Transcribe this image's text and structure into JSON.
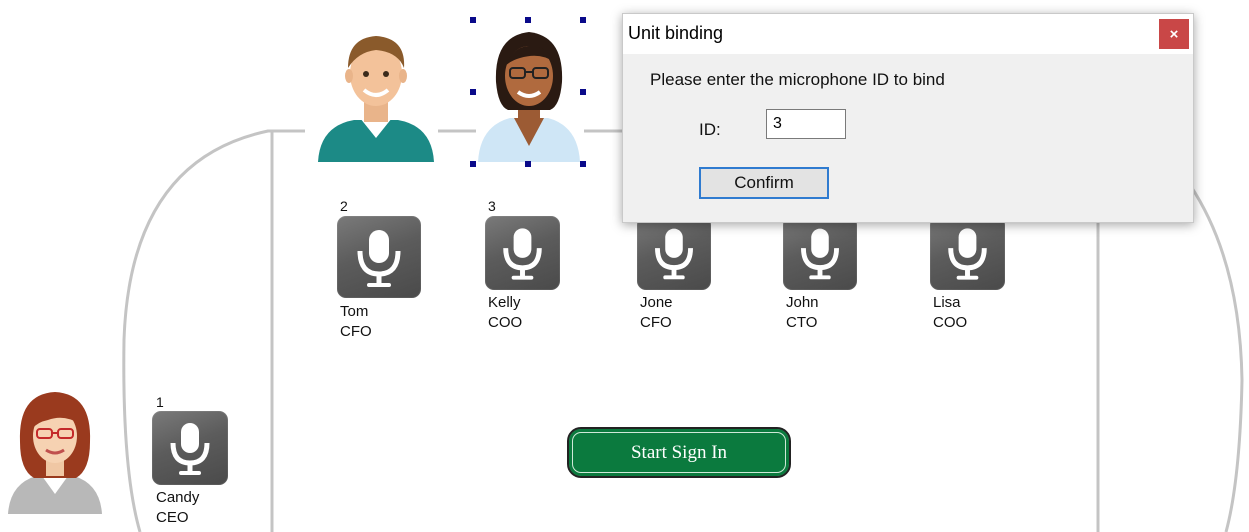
{
  "dialog": {
    "title": "Unit binding",
    "close_icon": "close-icon",
    "close_glyph": "×",
    "prompt": "Please enter the microphone ID to bind",
    "id_label": "ID:",
    "id_value": "3",
    "confirm_label": "Confirm"
  },
  "start_button": {
    "label": "Start Sign In"
  },
  "mic_units": [
    {
      "number": "1",
      "name": "Candy",
      "title": "CEO",
      "icon": "microphone-icon"
    },
    {
      "number": "2",
      "name": "Tom",
      "title": "CFO",
      "icon": "microphone-icon"
    },
    {
      "number": "3",
      "name": "Kelly",
      "title": "COO",
      "icon": "microphone-icon"
    },
    {
      "number": "",
      "name": "Jone",
      "title": "CFO",
      "icon": "microphone-icon"
    },
    {
      "number": "",
      "name": "John",
      "title": "CTO",
      "icon": "microphone-icon"
    },
    {
      "number": "",
      "name": "Lisa",
      "title": "COO",
      "icon": "microphone-icon"
    }
  ],
  "avatars": [
    {
      "icon": "avatar-man-green-sweater",
      "selected": false
    },
    {
      "icon": "avatar-woman-glasses-blue-shirt",
      "selected": true
    },
    {
      "icon": "avatar-woman-red-hair-glasses",
      "selected": false
    }
  ],
  "colors": {
    "start_button_bg": "#0b7a3e",
    "close_button_bg": "#c94747",
    "confirm_border": "#2f7bd0",
    "mic_tile": "#5c5c5c",
    "selection_handle": "#0a0a8a",
    "table_outline": "#c4c4c4"
  }
}
